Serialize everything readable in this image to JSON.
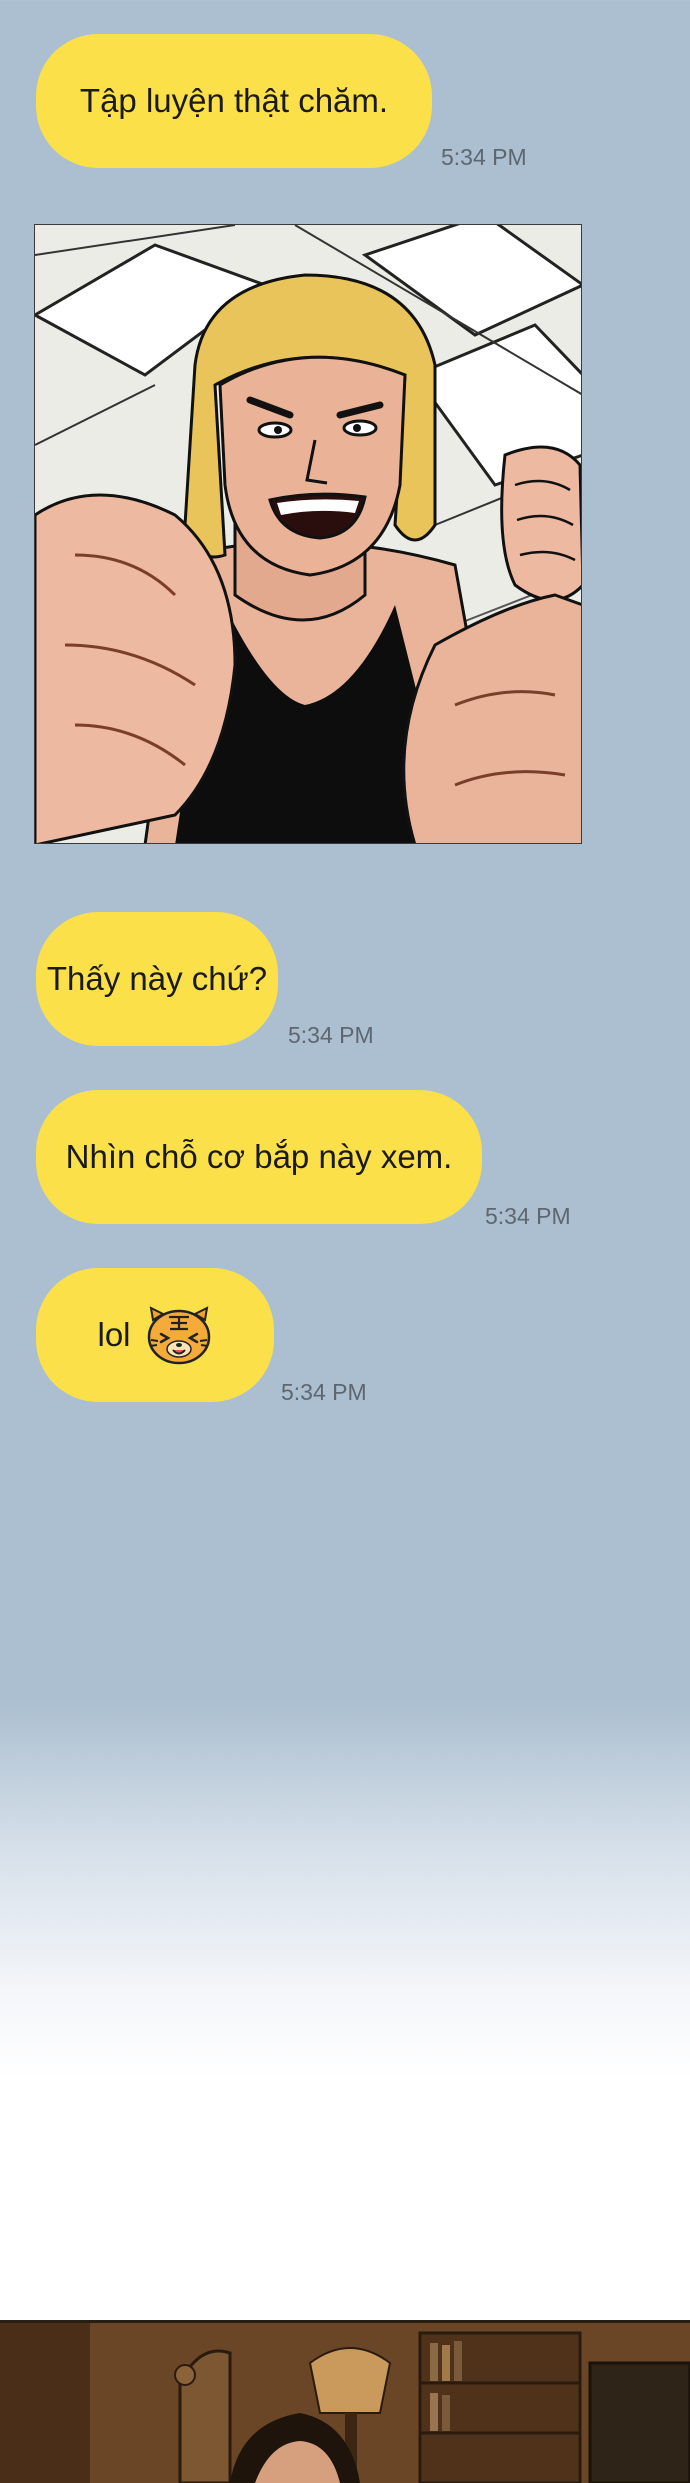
{
  "messages": [
    {
      "text": "Tập luyện thật chăm.",
      "time": "5:34 PM"
    },
    {
      "text": "Thấy này chứ?",
      "time": "5:34 PM"
    },
    {
      "text": "Nhìn chỗ cơ bắp này xem.",
      "time": "5:34 PM"
    },
    {
      "text": "lol",
      "time": "5:34 PM",
      "sticker": "tiger-emoji-icon"
    }
  ],
  "colors": {
    "chat_background": "#abbfd0",
    "bubble": "#fbe04a",
    "timestamp": "#5e6770"
  }
}
